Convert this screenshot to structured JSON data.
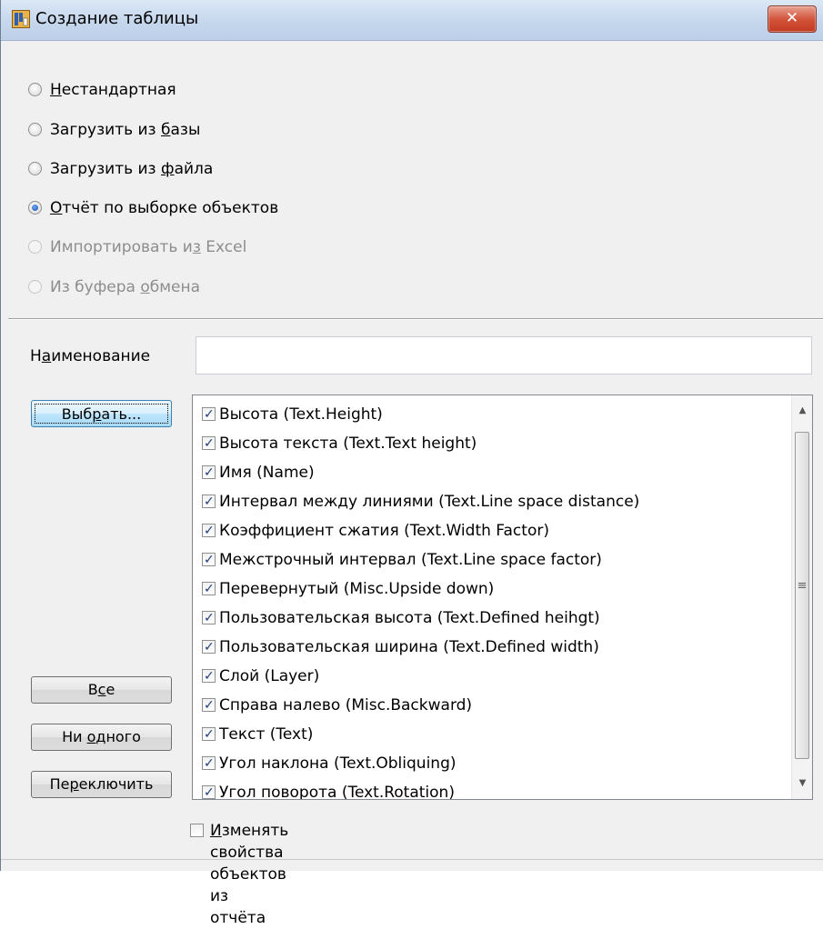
{
  "window": {
    "title": "Создание таблицы",
    "close_glyph": "✕"
  },
  "mode_options": [
    {
      "pre": "",
      "ul": "Н",
      "post": "естандартная",
      "checked": false,
      "disabled": false
    },
    {
      "pre": "Загрузить из ",
      "ul": "б",
      "post": "азы",
      "checked": false,
      "disabled": false
    },
    {
      "pre": "Загрузить из ",
      "ul": "ф",
      "post": "айла",
      "checked": false,
      "disabled": false
    },
    {
      "pre": "",
      "ul": "О",
      "post": "тчёт по выборке объектов",
      "checked": true,
      "disabled": false
    },
    {
      "pre": "Импортировать и",
      "ul": "з",
      "post": " Excel",
      "checked": false,
      "disabled": true
    },
    {
      "pre": "Из буфера ",
      "ul": "о",
      "post": "бмена",
      "checked": false,
      "disabled": true
    }
  ],
  "name_field": {
    "label_pre": "Н",
    "label_ul": "а",
    "label_post": "именование",
    "value": ""
  },
  "buttons": {
    "select": {
      "pre": "Выб",
      "ul": "р",
      "post": "ать..."
    },
    "all": {
      "pre": "В",
      "ul": "с",
      "post": "е"
    },
    "none": {
      "pre": "Ни ",
      "ul": "о",
      "post": "дного"
    },
    "toggle": {
      "pre": "Пе",
      "ul": "р",
      "post": "еключить"
    }
  },
  "properties": [
    {
      "label": "Высота (Text.Height)",
      "checked": true
    },
    {
      "label": "Высота текста (Text.Text height)",
      "checked": true
    },
    {
      "label": "Имя (Name)",
      "checked": true
    },
    {
      "label": "Интервал между линиями (Text.Line space distance)",
      "checked": true
    },
    {
      "label": "Коэффициент сжатия  (Text.Width Factor)",
      "checked": true
    },
    {
      "label": "Межстрочный интервал (Text.Line space factor)",
      "checked": true
    },
    {
      "label": "Перевернутый (Misc.Upside down)",
      "checked": true
    },
    {
      "label": "Пользовательская высота (Text.Defined heihgt)",
      "checked": true
    },
    {
      "label": "Пользовательская ширина (Text.Defined width)",
      "checked": true
    },
    {
      "label": "Слой (Layer)",
      "checked": true
    },
    {
      "label": "Справа налево (Misc.Backward)",
      "checked": true
    },
    {
      "label": "Текст (Text)",
      "checked": true
    },
    {
      "label": "Угол наклона (Text.Obliquing)",
      "checked": true
    },
    {
      "label": "Угол поворота (Text.Rotation)",
      "checked": true
    }
  ],
  "modify_props": {
    "pre": "",
    "ul": "И",
    "post": "зменять свойства объектов из отчёта",
    "checked": false
  },
  "icons": {
    "app": "table-app-icon",
    "close": "close-icon",
    "scroll_up": "chevron-up-icon",
    "scroll_down": "chevron-down-icon",
    "grip": "scrollbar-grip-icon"
  }
}
